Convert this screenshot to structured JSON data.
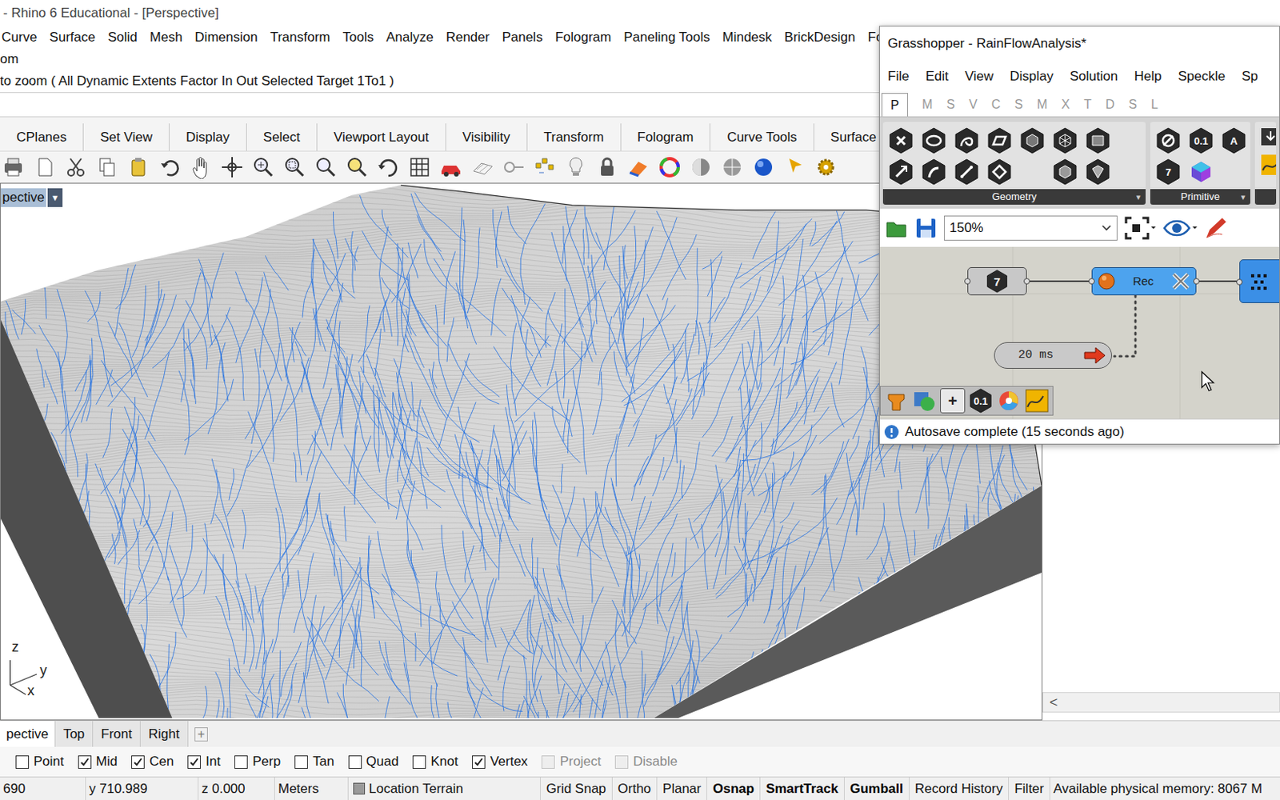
{
  "rhino": {
    "title": "- Rhino 6 Educational - [Perspective]",
    "menu": [
      "Curve",
      "Surface",
      "Solid",
      "Mesh",
      "Dimension",
      "Transform",
      "Tools",
      "Analyze",
      "Render",
      "Panels",
      "Fologram",
      "Paneling Tools",
      "Mindesk",
      "BrickDesign",
      "Fo"
    ],
    "command_history": [
      "om",
      "to zoom ( All Dynamic Extents Factor In Out Selected Target 1To1 )"
    ],
    "toolbar_tabs": [
      "CPlanes",
      "Set View",
      "Display",
      "Select",
      "Viewport Layout",
      "Visibility",
      "Transform",
      "Fologram",
      "Curve Tools",
      "Surface Tools"
    ],
    "viewport": {
      "label": "pective",
      "menu_arrow": "▼",
      "axes": [
        "z",
        "y",
        "x"
      ]
    },
    "viewport_tabs": [
      {
        "label": "pective",
        "selected": true
      },
      {
        "label": "Top",
        "selected": false
      },
      {
        "label": "Front",
        "selected": false
      },
      {
        "label": "Right",
        "selected": false
      }
    ],
    "add_tab": "+",
    "osnaps": [
      {
        "label": "Point",
        "checked": false,
        "disabled": false
      },
      {
        "label": "Mid",
        "checked": true,
        "disabled": false
      },
      {
        "label": "Cen",
        "checked": true,
        "disabled": false
      },
      {
        "label": "Int",
        "checked": true,
        "disabled": false
      },
      {
        "label": "Perp",
        "checked": false,
        "disabled": false
      },
      {
        "label": "Tan",
        "checked": false,
        "disabled": false
      },
      {
        "label": "Quad",
        "checked": false,
        "disabled": false
      },
      {
        "label": "Knot",
        "checked": false,
        "disabled": false
      },
      {
        "label": "Vertex",
        "checked": true,
        "disabled": false
      },
      {
        "label": "Project",
        "checked": false,
        "disabled": true
      },
      {
        "label": "Disable",
        "checked": false,
        "disabled": true
      }
    ],
    "status_bar": {
      "x": "690",
      "y": "y 710.989",
      "z": "z 0.000",
      "units": "Meters",
      "layer": "Location Terrain",
      "toggles": [
        {
          "label": "Grid Snap",
          "on": false
        },
        {
          "label": "Ortho",
          "on": false
        },
        {
          "label": "Planar",
          "on": false
        },
        {
          "label": "Osnap",
          "on": true
        },
        {
          "label": "SmartTrack",
          "on": true
        },
        {
          "label": "Gumball",
          "on": true
        },
        {
          "label": "Record History",
          "on": false
        },
        {
          "label": "Filter",
          "on": false
        }
      ],
      "memory": "Available physical memory: 8067 M"
    },
    "scroll_arrow": "<"
  },
  "grasshopper": {
    "title": "Grasshopper - RainFlowAnalysis*",
    "menu": [
      "File",
      "Edit",
      "View",
      "Display",
      "Solution",
      "Help",
      "Speckle",
      "Sp"
    ],
    "tabs": [
      {
        "label": "P",
        "selected": true
      },
      {
        "label": "M",
        "selected": false
      },
      {
        "label": "S",
        "selected": false
      },
      {
        "label": "V",
        "selected": false
      },
      {
        "label": "C",
        "selected": false
      },
      {
        "label": "S",
        "selected": false
      },
      {
        "label": "M",
        "selected": false
      },
      {
        "label": "X",
        "selected": false
      },
      {
        "label": "T",
        "selected": false
      },
      {
        "label": "D",
        "selected": false
      },
      {
        "label": "S",
        "selected": false
      },
      {
        "label": "L",
        "selected": false
      }
    ],
    "panels": [
      {
        "label": "Geometry",
        "expander": "▾"
      },
      {
        "label": "Primitive",
        "expander": "▾"
      }
    ],
    "primitive_icons": [
      "0.1",
      "A",
      "7"
    ],
    "zoom": "150%",
    "nodes": {
      "number": "7",
      "record": "Rec",
      "timer": "20 ms"
    },
    "bottom_icons": [
      "+",
      "0.1"
    ],
    "status": "Autosave complete (15 seconds ago)"
  }
}
